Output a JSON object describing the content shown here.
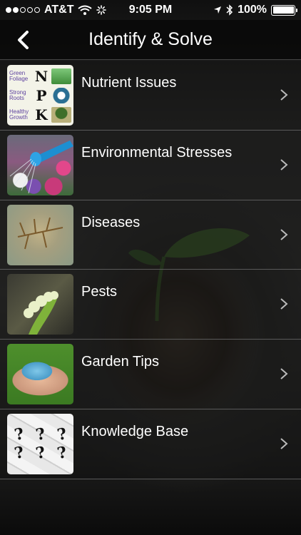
{
  "status_bar": {
    "carrier": "AT&T",
    "time": "9:05 PM",
    "battery": "100%",
    "signal_bars": 2,
    "battery_level": 1.0
  },
  "nav": {
    "title": "Identify & Solve",
    "back_icon": "chevron-left-icon"
  },
  "list": {
    "items": [
      {
        "label": "Nutrient Issues",
        "thumbnail": {
          "rows": [
            {
              "word": "Green Foliage",
              "letter": "N"
            },
            {
              "word": "Strong Roots",
              "letter": "P"
            },
            {
              "word": "Healthy Growth",
              "letter": "K"
            }
          ]
        }
      },
      {
        "label": "Environmental Stresses"
      },
      {
        "label": "Diseases"
      },
      {
        "label": "Pests"
      },
      {
        "label": "Garden Tips"
      },
      {
        "label": "Knowledge Base",
        "thumbnail": {
          "glyph": "?"
        }
      }
    ]
  },
  "colors": {
    "navbar_bg": "#0a0a0a",
    "row_divider": "#5a5a5a",
    "text": "#ffffff",
    "chevron": "#bbbbbb"
  }
}
